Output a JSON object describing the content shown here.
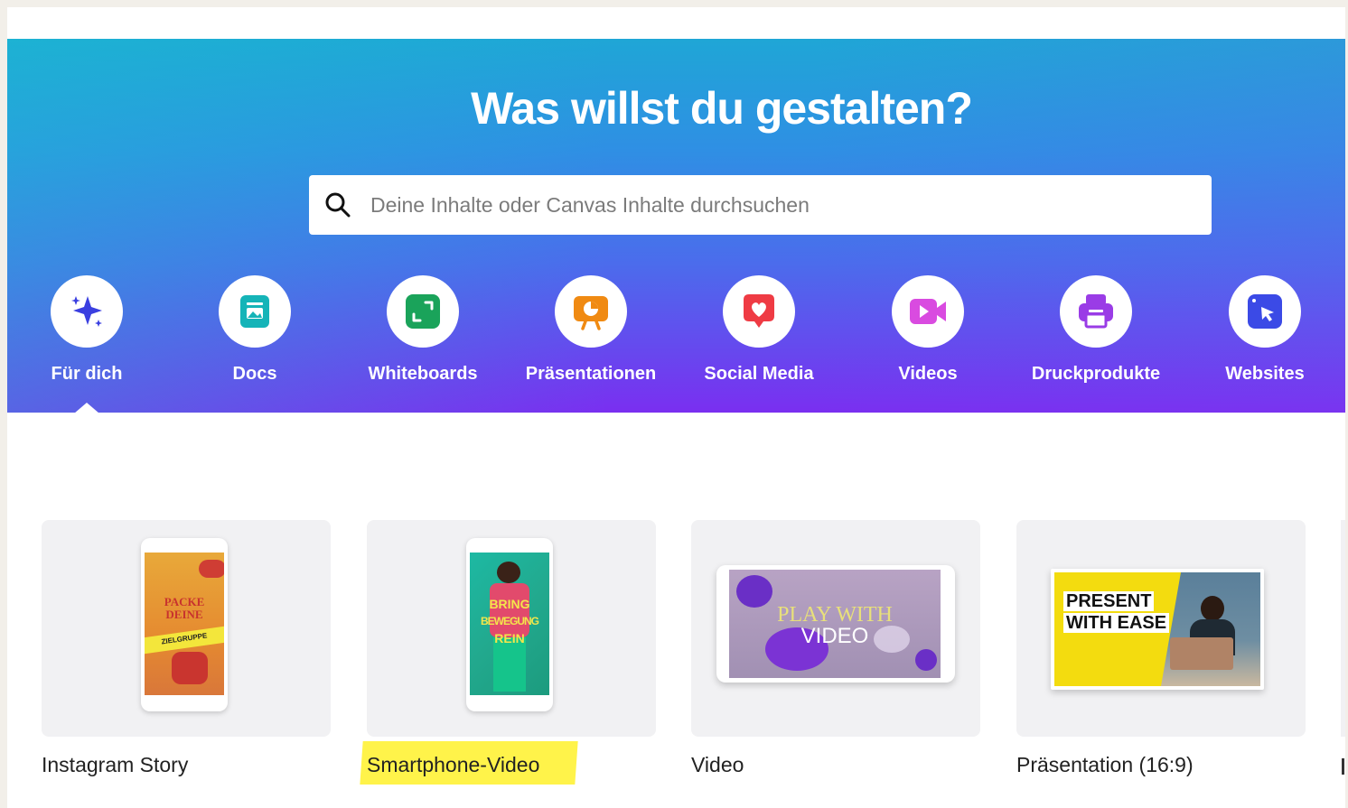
{
  "hero": {
    "title": "Was willst du gestalten?",
    "search_placeholder": "Deine Inhalte oder Canvas Inhalte durchsuchen"
  },
  "categories": [
    {
      "label": "Für dich",
      "icon": "sparkles-icon",
      "color": "#3a3fe0"
    },
    {
      "label": "Docs",
      "icon": "doc-icon",
      "color": "#15b4b8"
    },
    {
      "label": "Whiteboards",
      "icon": "whiteboard-icon",
      "color": "#1aa35a"
    },
    {
      "label": "Präsentationen",
      "icon": "presentation-icon",
      "color": "#f08a12"
    },
    {
      "label": "Social Media",
      "icon": "heart-icon",
      "color": "#ef3b44"
    },
    {
      "label": "Videos",
      "icon": "video-camera-icon",
      "color": "#d94be0"
    },
    {
      "label": "Druckprodukte",
      "icon": "printer-icon",
      "color": "#9a3ce6"
    },
    {
      "label": "Websites",
      "icon": "cursor-icon",
      "color": "#3b4ae6"
    }
  ],
  "active_category": "Für dich",
  "templates": [
    {
      "label": "Instagram Story",
      "art": [
        "PACKE",
        "DEINE",
        "ZIELGRUPPE"
      ]
    },
    {
      "label": "Smartphone-Video",
      "highlighted": true,
      "art": [
        "BRING",
        "BEWEGUNG",
        "REIN"
      ]
    },
    {
      "label": "Video",
      "art": [
        "PLAY WITH",
        "VIDEO"
      ]
    },
    {
      "label": "Präsentation (16:9)",
      "art": [
        "PRESENT",
        "WITH EASE"
      ]
    }
  ]
}
